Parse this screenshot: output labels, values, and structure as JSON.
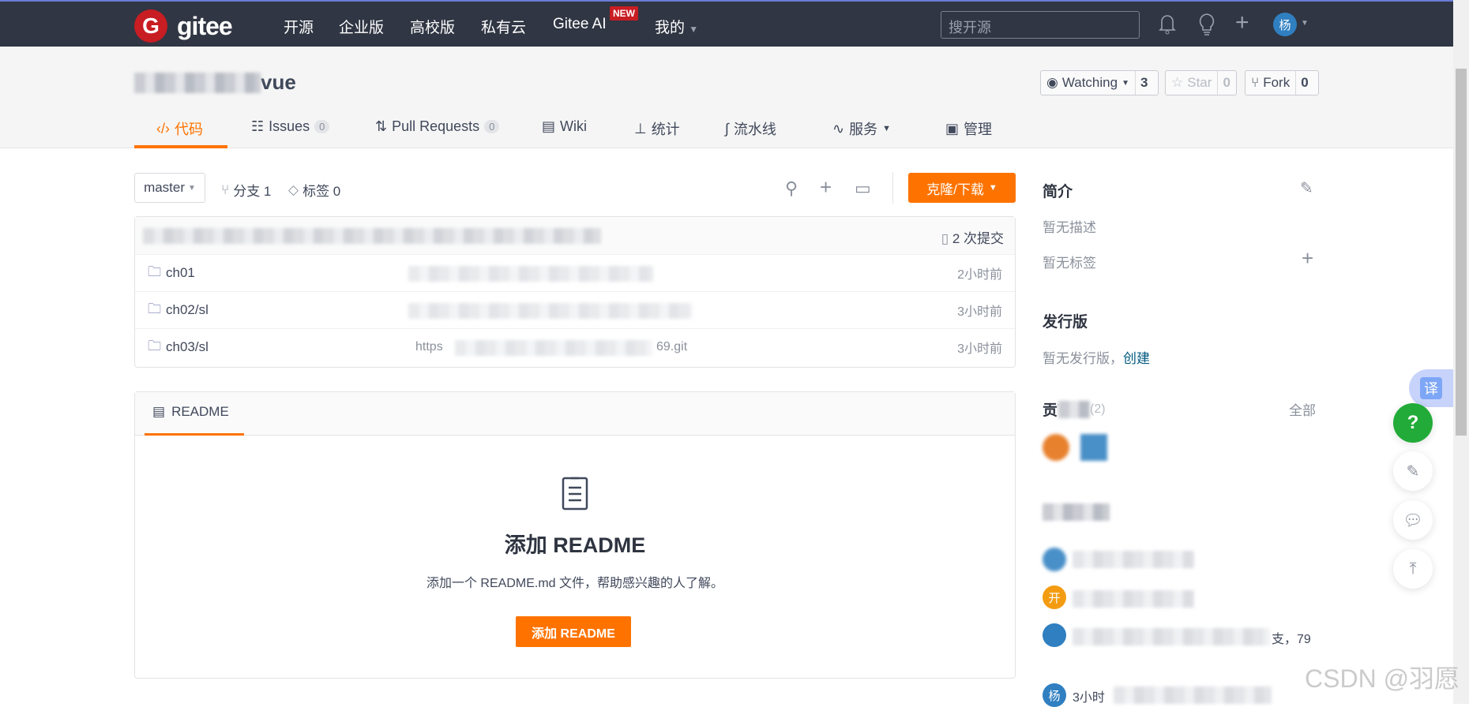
{
  "navbar": {
    "logo_letter": "G",
    "logo_text": "gitee",
    "items": [
      "开源",
      "企业版",
      "高校版",
      "私有云",
      "Gitee AI",
      "我的"
    ],
    "new_badge": "NEW",
    "search_placeholder": "搜开源",
    "avatar_text": "杨"
  },
  "repo": {
    "name_visible": "vue",
    "watch": {
      "label": "Watching",
      "count": "3"
    },
    "star": {
      "label": "Star",
      "count": "0"
    },
    "fork": {
      "label": "Fork",
      "count": "0"
    }
  },
  "tabs": [
    {
      "label": "代码"
    },
    {
      "label": "Issues",
      "count": "0"
    },
    {
      "label": "Pull Requests",
      "count": "0"
    },
    {
      "label": "Wiki"
    },
    {
      "label": "统计"
    },
    {
      "label": "流水线"
    },
    {
      "label": "服务"
    },
    {
      "label": "管理"
    }
  ],
  "toolbar": {
    "branch": "master",
    "branches": "分支 1",
    "tags": "标签 0",
    "clone": "克隆/下载"
  },
  "files": {
    "commits": "2 次提交",
    "rows": [
      {
        "name": "ch01",
        "time": "2小时前"
      },
      {
        "name": "ch02/sl",
        "time": "3小时前"
      },
      {
        "name": "ch03/sl",
        "time": "3小时前",
        "msg_visible": "https",
        "msg_end": "69.git"
      }
    ]
  },
  "readme": {
    "tab": "README",
    "title": "添加 README",
    "desc": "添加一个 README.md 文件，帮助感兴趣的人了解。",
    "button": "添加 README"
  },
  "sidebar": {
    "intro": "简介",
    "no_desc": "暂无描述",
    "no_tags": "暂无标签",
    "releases": "发行版",
    "no_release": "暂无发行版，",
    "create": "创建",
    "contributors": "贡献",
    "contributors_count": "(2)",
    "all": "全部",
    "activity_avatar": "开",
    "activity_tail": "支，79",
    "activity_avatar2": "杨",
    "activity_prefix": "3小时"
  },
  "floating": {
    "translate": "译",
    "help": "?"
  },
  "watermark": "CSDN @羽愿",
  "colors": {
    "nav_bg": "#303643",
    "accent": "#fe7300",
    "link": "#005980",
    "help_green": "#22ab38"
  }
}
